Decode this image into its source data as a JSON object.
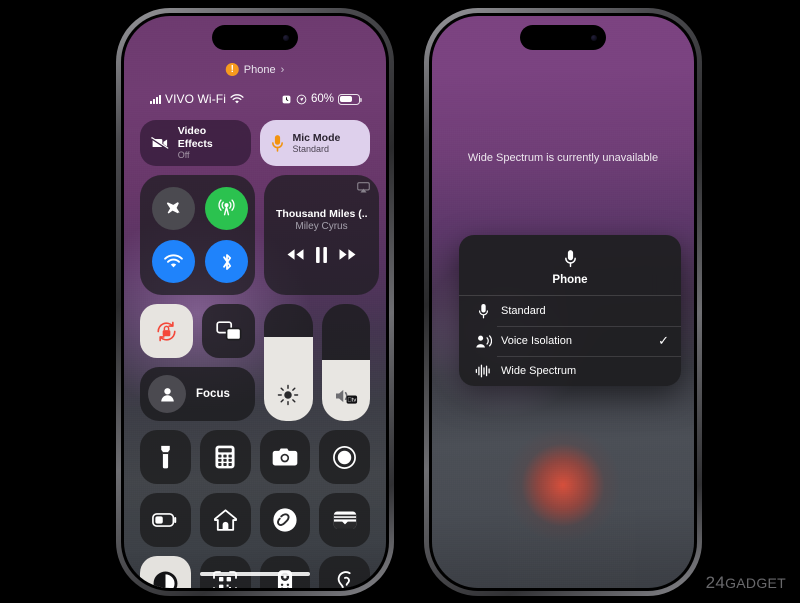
{
  "watermark": {
    "prefix": "24",
    "suffix": "GADGET"
  },
  "left_phone": {
    "dynamic_island_pill": {
      "badge": "!",
      "label": "Phone",
      "chevron": "›"
    },
    "status_bar": {
      "signal_icon": "cellular-bars-icon",
      "carrier": "VIVO Wi-Fi",
      "wifi_icon": "wifi-icon",
      "alarm_icon": "alarm-icon",
      "location_icon": "location-icon",
      "battery_percent": "60%",
      "battery_level": 60
    },
    "call_tiles": [
      {
        "name": "video-effects",
        "title": "Video Effects",
        "subtitle": "Off",
        "icon": "video-off-icon",
        "active": false
      },
      {
        "name": "mic-mode",
        "title": "Mic Mode",
        "subtitle": "Standard",
        "icon": "microphone-icon",
        "active": true
      }
    ],
    "connectivity": [
      {
        "name": "airplane-mode",
        "icon": "airplane-icon",
        "color": "#4b4a50",
        "on": false
      },
      {
        "name": "cellular-data",
        "icon": "cellular-tower-icon",
        "color": "#2bc24f",
        "on": true
      },
      {
        "name": "wifi",
        "icon": "wifi-icon",
        "color": "#1f83fb",
        "on": true
      },
      {
        "name": "bluetooth",
        "icon": "bluetooth-icon",
        "color": "#1f83fb",
        "on": true
      }
    ],
    "now_playing": {
      "title": "Thousand Miles (...",
      "artist": "Miley Cyrus",
      "airplay_icon": "airplay-icon",
      "controls": [
        {
          "name": "rewind",
          "icon": "rewind-icon"
        },
        {
          "name": "pause",
          "icon": "pause-icon"
        },
        {
          "name": "fast-forward",
          "icon": "fast-forward-icon"
        }
      ]
    },
    "small_tiles": [
      {
        "name": "rotation-lock",
        "icon": "rotation-lock-icon",
        "active": true
      },
      {
        "name": "screen-mirroring",
        "icon": "screen-mirroring-icon",
        "active": false
      }
    ],
    "focus": {
      "label": "Focus",
      "icon": "person-icon"
    },
    "sliders": [
      {
        "name": "brightness",
        "icon": "brightness-icon",
        "value": 72
      },
      {
        "name": "volume",
        "icon": "volume-icon",
        "value": 52,
        "badge": "apple-tv-icon"
      }
    ],
    "grid": [
      {
        "name": "flashlight",
        "icon": "flashlight-icon",
        "light": false
      },
      {
        "name": "calculator",
        "icon": "calculator-icon",
        "light": false
      },
      {
        "name": "camera",
        "icon": "camera-icon",
        "light": false
      },
      {
        "name": "screen-record",
        "icon": "record-icon",
        "light": false
      },
      {
        "name": "low-power-mode",
        "icon": "battery-icon",
        "light": false
      },
      {
        "name": "home",
        "icon": "home-icon",
        "light": false
      },
      {
        "name": "shazam",
        "icon": "shazam-icon",
        "light": false
      },
      {
        "name": "wallet",
        "icon": "wallet-icon",
        "light": false
      },
      {
        "name": "dark-mode",
        "icon": "dark-mode-icon",
        "light": true
      },
      {
        "name": "code-scanner",
        "icon": "qr-scanner-icon",
        "light": false
      },
      {
        "name": "apple-tv-remote",
        "icon": "remote-icon",
        "light": false
      },
      {
        "name": "hearing",
        "icon": "ear-icon",
        "light": false
      }
    ]
  },
  "right_phone": {
    "notice": "Wide Spectrum is currently unavailable",
    "mic_menu": {
      "header_icon": "microphone-icon",
      "header_label": "Phone",
      "options": [
        {
          "name": "standard",
          "icon": "microphone-icon",
          "label": "Standard",
          "selected": false
        },
        {
          "name": "voice-isolation",
          "icon": "voice-isolation-icon",
          "label": "Voice Isolation",
          "selected": true,
          "check": "✓"
        },
        {
          "name": "wide-spectrum",
          "icon": "wide-spectrum-icon",
          "label": "Wide Spectrum",
          "selected": false
        }
      ]
    }
  }
}
